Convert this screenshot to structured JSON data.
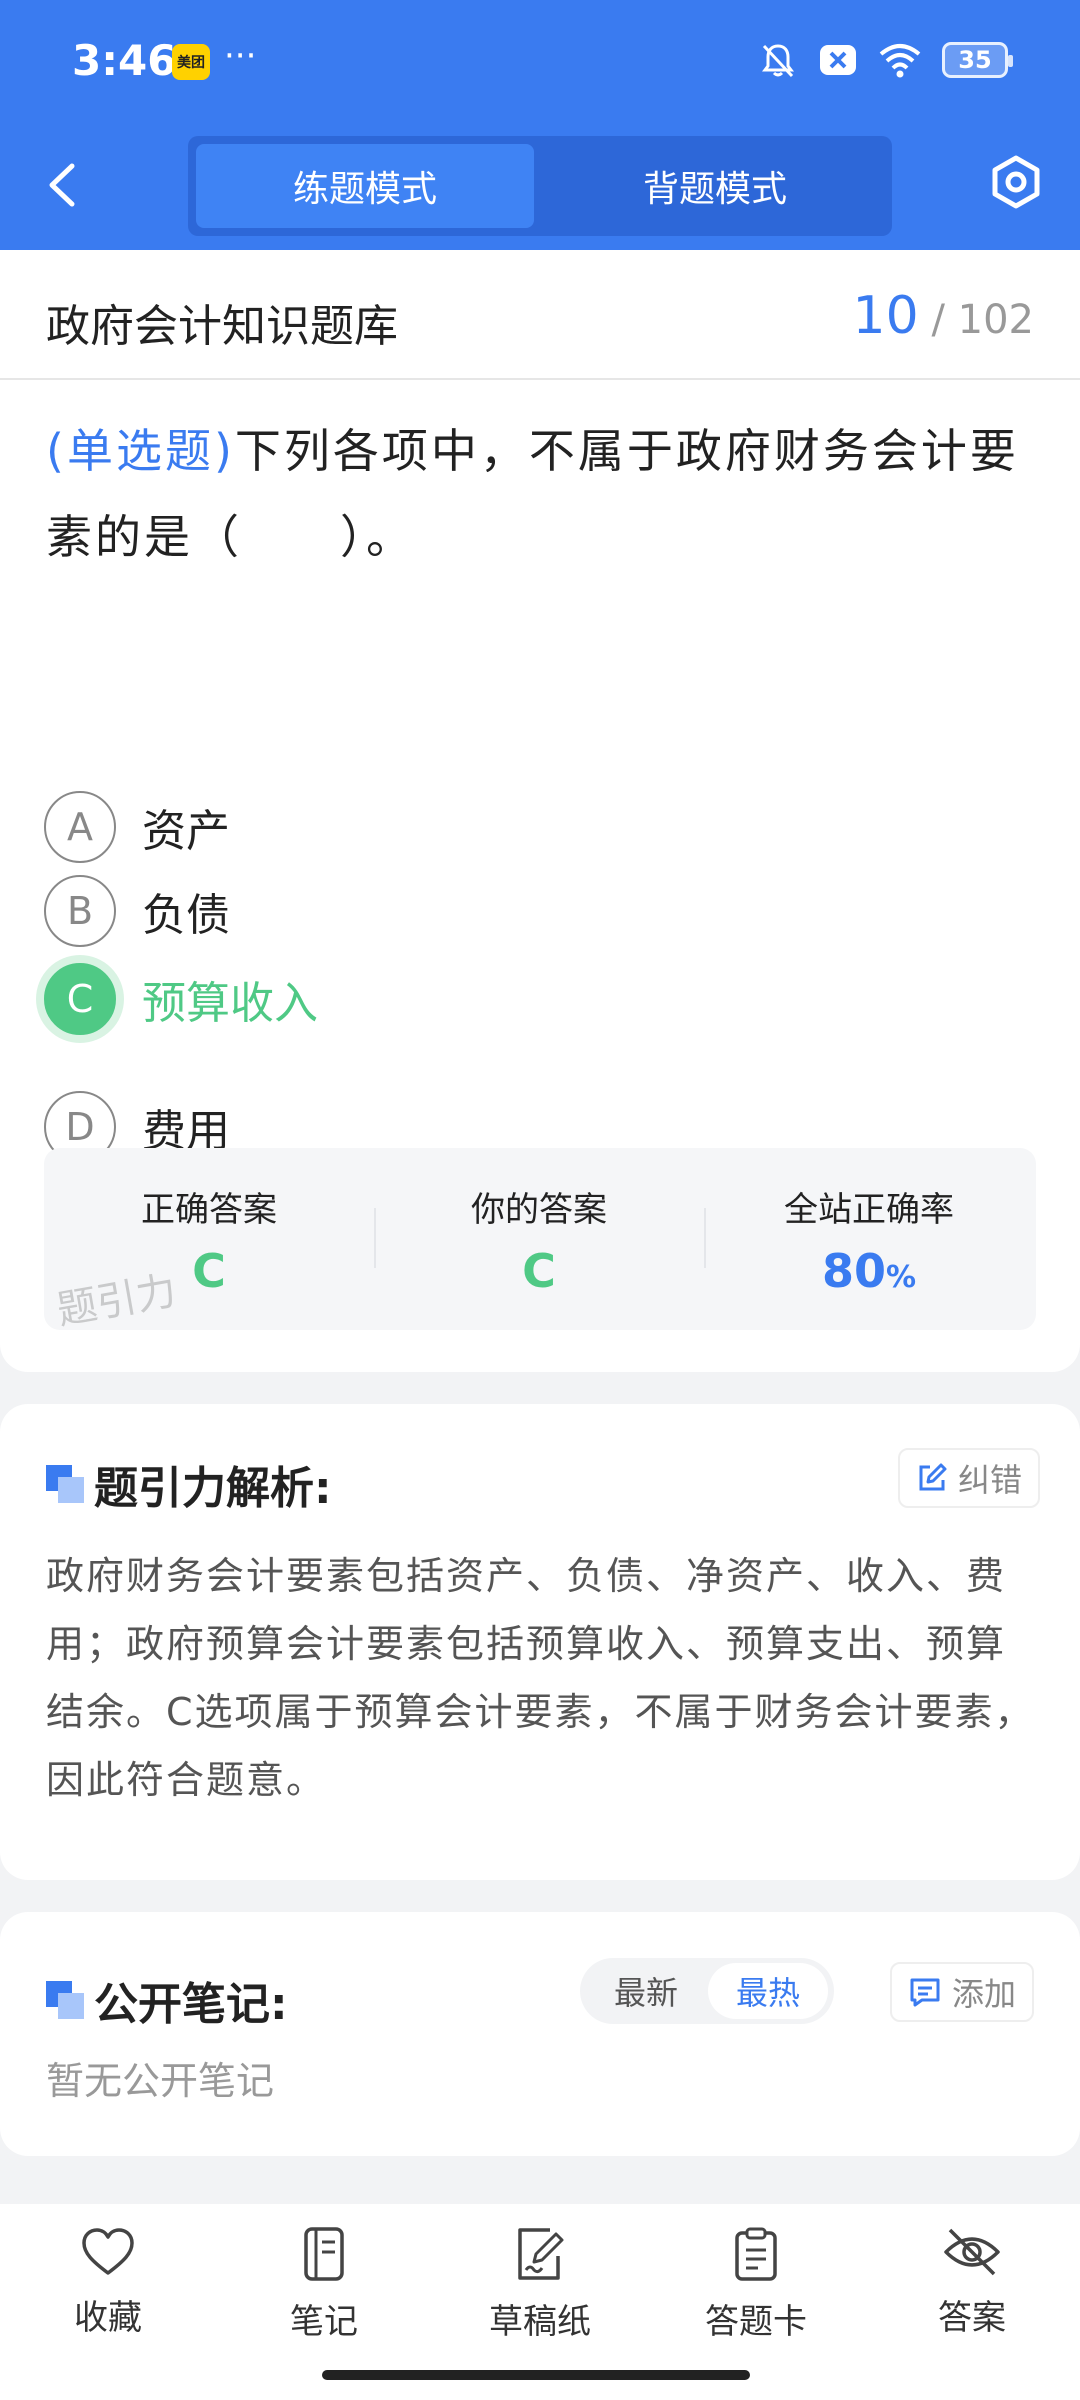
{
  "status_bar": {
    "time": "3:46",
    "app_badge": "美团",
    "more": "···",
    "battery": "35",
    "icons": [
      "bell-off-icon",
      "close-badge-icon",
      "wifi-icon",
      "battery-icon"
    ]
  },
  "header": {
    "modes": [
      "练题模式",
      "背题模式"
    ],
    "active_mode": "练题模式",
    "icons": [
      "back-arrow-icon",
      "settings-icon"
    ]
  },
  "bank": {
    "title": "政府会计知识题库",
    "current": "10",
    "separator": "/",
    "total": "102"
  },
  "question": {
    "type": "(单选题)",
    "stem": "下列各项中，不属于政府财务会计要素的是（　　）。",
    "options": [
      {
        "letter": "A",
        "text": "资产"
      },
      {
        "letter": "B",
        "text": "负债"
      },
      {
        "letter": "C",
        "text": "预算收入"
      },
      {
        "letter": "D",
        "text": "费用"
      }
    ],
    "selected": "C"
  },
  "result": {
    "correct_label": "正确答案",
    "correct_value": "C",
    "yours_label": "你的答案",
    "yours_value": "C",
    "rate_label": "全站正确率",
    "rate_value": "80",
    "rate_unit": "%",
    "watermark": "题引力"
  },
  "analysis": {
    "title": "题引力解析:",
    "report_label": "纠错",
    "text": "政府财务会计要素包括资产、负债、净资产、收入、费用；政府预算会计要素包括预算收入、预算支出、预算结余。C选项属于预算会计要素，不属于财务会计要素，因此符合题意。"
  },
  "notes": {
    "title": "公开笔记:",
    "sort_options": [
      "最新",
      "最热"
    ],
    "active_sort": "最热",
    "add_label": "添加",
    "empty": "暂无公开笔记"
  },
  "bottom_nav": [
    {
      "label": "收藏",
      "icon": "heart-icon"
    },
    {
      "label": "笔记",
      "icon": "notebook-icon"
    },
    {
      "label": "草稿纸",
      "icon": "draft-pen-icon"
    },
    {
      "label": "答题卡",
      "icon": "clipboard-icon"
    },
    {
      "label": "答案",
      "icon": "eye-off-icon"
    }
  ],
  "colors": {
    "primary": "#3a7bf0",
    "correct": "#4fc985"
  }
}
